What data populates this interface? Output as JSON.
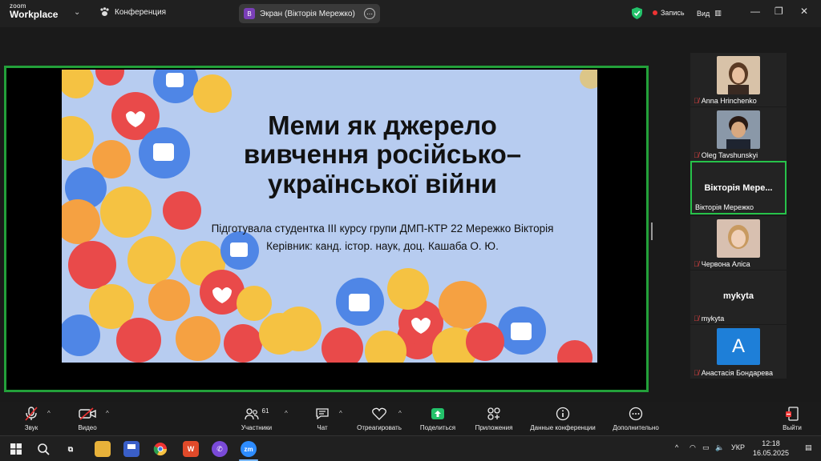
{
  "titlebar": {
    "logo_small": "zoom",
    "logo_big": "Workplace",
    "conference": "Конференция",
    "screen_badge": "В",
    "screen_label": "Экран (Вікторія Мережко)",
    "recording": "Запись",
    "view": "Вид"
  },
  "slide": {
    "title_line1": "Меми як джерело",
    "title_line2": "вивчення російсько–",
    "title_line3": "української війни",
    "sub_line1": "Підготувала студентка ІІІ курсу групи ДМП-КТР 22 Мережко Вікторія",
    "sub_line2": "Керівник: канд. істор. наук, доц. Кашаба О. Ю."
  },
  "participants": [
    {
      "name": "Anna Hrinchenko",
      "muted": true
    },
    {
      "name": "Oleg Tavshunskyi",
      "muted": true
    },
    {
      "name": "Вікторія Мережко",
      "display": "Вікторія Мере...",
      "active": true
    },
    {
      "name": "Червона Аліса",
      "muted": true
    },
    {
      "name": "mykyta",
      "display": "mykyta",
      "muted": true
    },
    {
      "name": "Анастасія Бондарева",
      "initial": "А",
      "muted": true
    }
  ],
  "toolbar": {
    "audio": "Звук",
    "video": "Видео",
    "participants": "Участники",
    "participants_count": "61",
    "chat": "Чат",
    "react": "Отреагировать",
    "share": "Поделиться",
    "apps": "Приложения",
    "meeting_info": "Данные конференции",
    "more": "Дополнительно",
    "leave": "Выйти"
  },
  "taskbar": {
    "lang": "УКР",
    "time": "12:18",
    "date": "16.05.2025",
    "zoom_label": "zm"
  },
  "colors": {
    "share_border": "#23a03a",
    "active_border": "#27c24a",
    "share_button": "#23c26a"
  }
}
